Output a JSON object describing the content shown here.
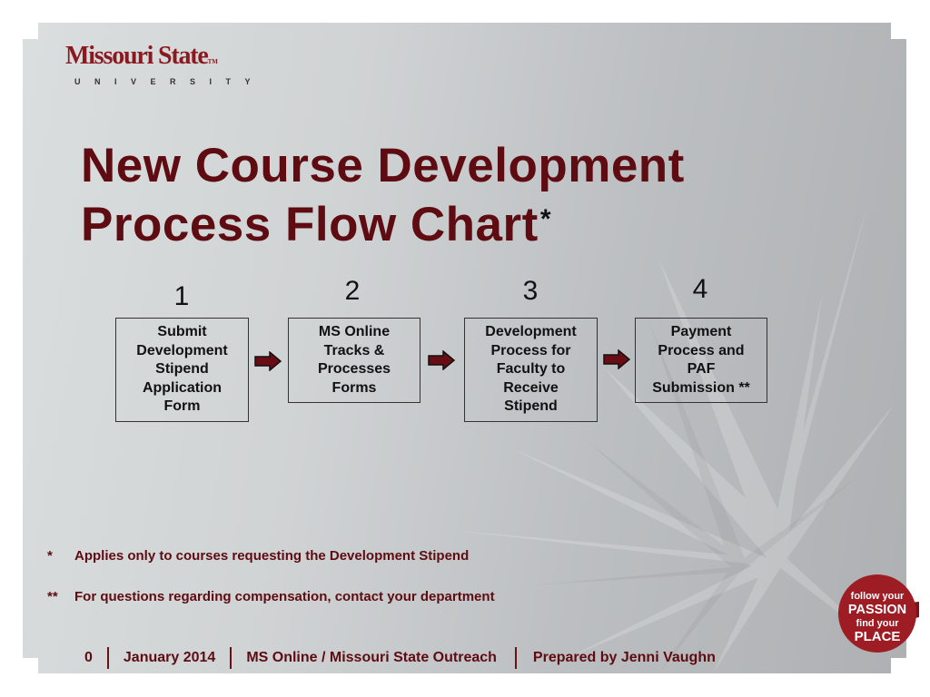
{
  "logo": {
    "name": "Missouri State",
    "trademark": "TM",
    "subtitle": "UNIVERSITY"
  },
  "title": {
    "line1": "New Course Development",
    "line2": "Process Flow Chart",
    "asterisk": "*"
  },
  "steps": [
    {
      "number": "1",
      "label": "Submit\nDevelopment\nStipend\nApplication\nForm"
    },
    {
      "number": "2",
      "label": "MS Online\nTracks &\nProcesses\nForms"
    },
    {
      "number": "3",
      "label": "Development\nProcess for\nFaculty to\nReceive\nStipend"
    },
    {
      "number": "4",
      "label": "Payment\nProcess and\nPAF\nSubmission **"
    }
  ],
  "arrows": [
    {
      "icon": "right-arrow-icon",
      "from": "1",
      "to": "2"
    },
    {
      "icon": "right-arrow-icon",
      "from": "2",
      "to": "3"
    },
    {
      "icon": "right-arrow-icon",
      "from": "3",
      "to": "4"
    }
  ],
  "notes": [
    {
      "mark": "*",
      "text": "Applies only to courses requesting the Development Stipend"
    },
    {
      "mark": "**",
      "text": "For questions regarding compensation, contact your department"
    }
  ],
  "footer": {
    "page": "0",
    "date": "January 2014",
    "department": "MS Online / Missouri State Outreach",
    "prepared_by": "Prepared by Jenni Vaughn"
  },
  "badge": {
    "line1": "follow your",
    "line2": "PASSION",
    "line3": "find your",
    "line4": "PLACE"
  },
  "colors": {
    "brand_maroon": "#5e0b12",
    "logo_red": "#8a1a1f",
    "badge_red": "#9e1c24",
    "arrow_fill": "#6a0c14"
  }
}
